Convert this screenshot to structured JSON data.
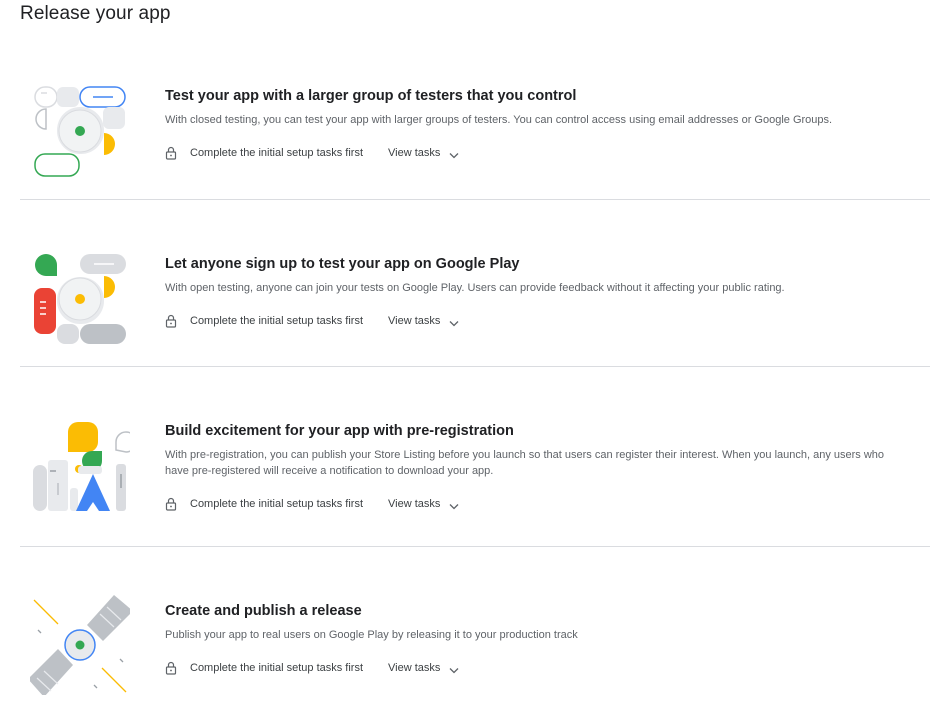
{
  "page": {
    "title": "Release your app"
  },
  "cards": [
    {
      "title": "Test your app with a larger group of testers that you control",
      "description": "With closed testing, you can test your app with larger groups of testers. You can control access using email addresses or Google Groups.",
      "status_text": "Complete the initial setup tasks first",
      "action_label": "View tasks"
    },
    {
      "title": "Let anyone sign up to test your app on Google Play",
      "description": "With open testing, anyone can join your tests on Google Play. Users can provide feedback without it affecting your public rating.",
      "status_text": "Complete the initial setup tasks first",
      "action_label": "View tasks"
    },
    {
      "title": "Build excitement for your app with pre-registration",
      "description": "With pre-registration, you can publish your Store Listing before you launch so that users can register their interest. When you launch, any users who have pre-registered will receive a notification to download your app.",
      "status_text": "Complete the initial setup tasks first",
      "action_label": "View tasks"
    },
    {
      "title": "Create and publish a release",
      "description": "Publish your app to real users on Google Play by releasing it to your production track",
      "status_text": "Complete the initial setup tasks first",
      "action_label": "View tasks"
    }
  ],
  "colors": {
    "green": "#34a853",
    "yellow": "#fbbc04",
    "red": "#ea4335",
    "blue": "#4285f4",
    "grey": "#dadce0",
    "divider": "#dadce0"
  },
  "icons": [
    "lock-icon",
    "chevron-down-icon"
  ]
}
